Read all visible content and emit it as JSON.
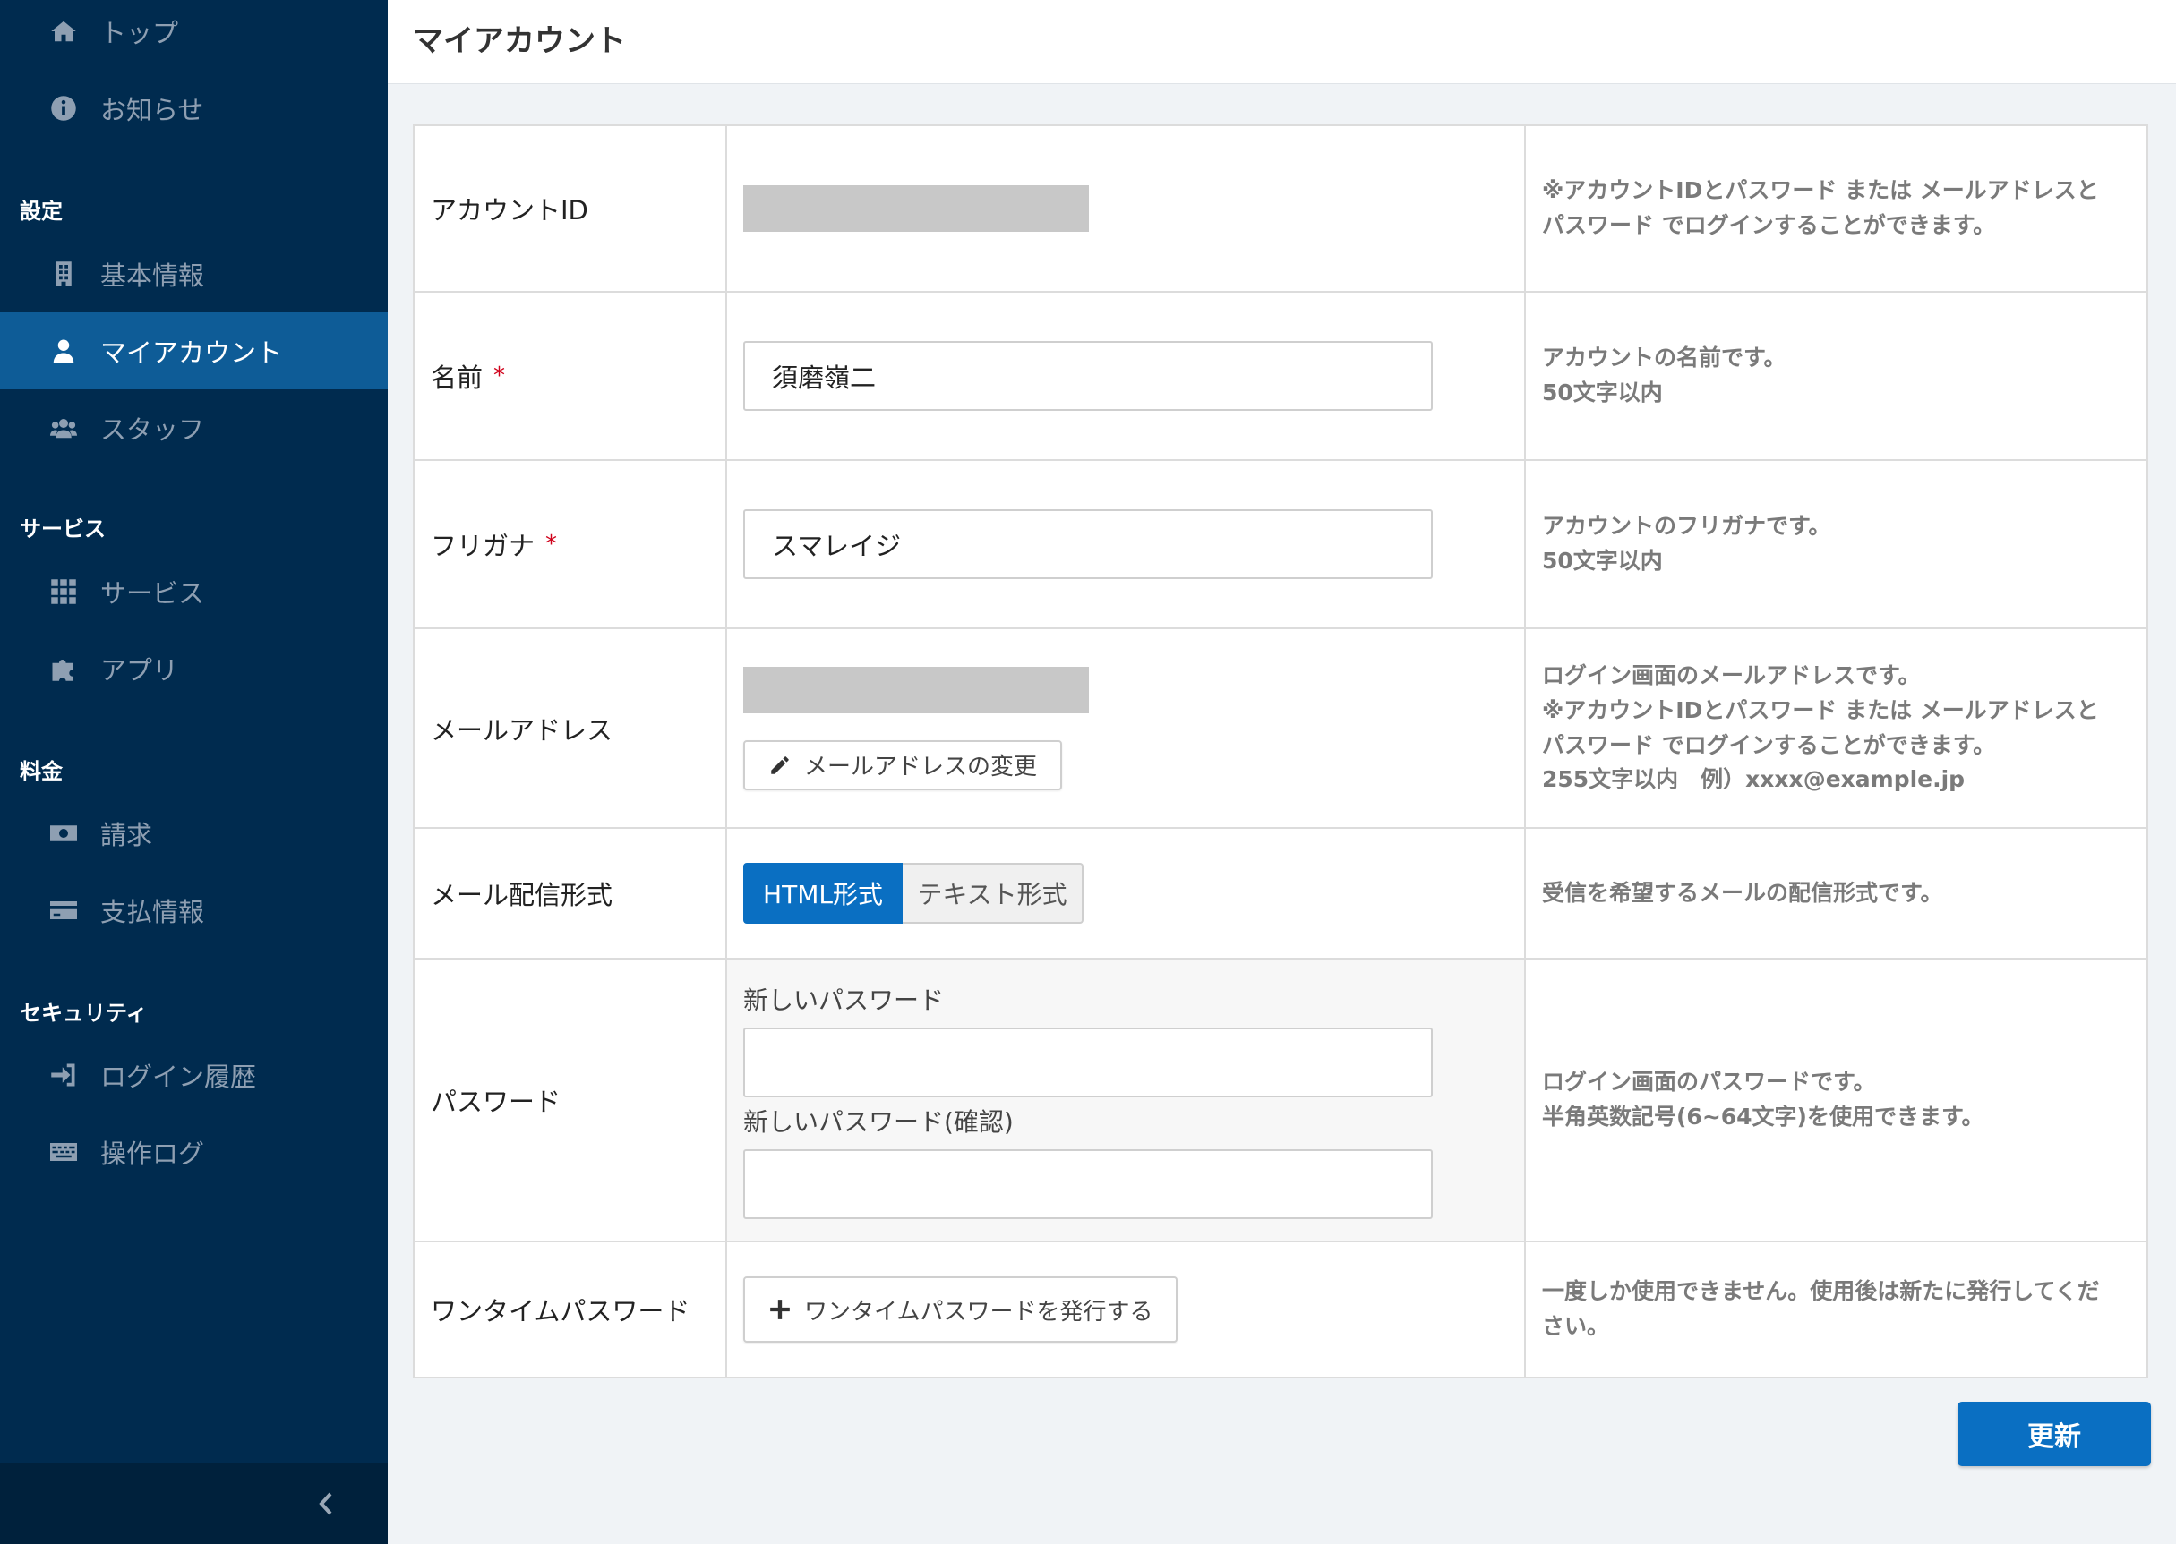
{
  "sidebar": {
    "items_top": [
      {
        "label": "トップ",
        "icon": "home-icon"
      },
      {
        "label": "お知らせ",
        "icon": "info-icon"
      }
    ],
    "sections": [
      {
        "title": "設定",
        "items": [
          {
            "label": "基本情報",
            "icon": "building-icon"
          },
          {
            "label": "マイアカウント",
            "icon": "user-icon",
            "active": true
          },
          {
            "label": "スタッフ",
            "icon": "users-icon"
          }
        ]
      },
      {
        "title": "サービス",
        "items": [
          {
            "label": "サービス",
            "icon": "grid-icon"
          },
          {
            "label": "アプリ",
            "icon": "puzzle-icon"
          }
        ]
      },
      {
        "title": "料金",
        "items": [
          {
            "label": "請求",
            "icon": "money-icon"
          },
          {
            "label": "支払情報",
            "icon": "credit-card-icon"
          }
        ]
      },
      {
        "title": "セキュリティ",
        "items": [
          {
            "label": "ログイン履歴",
            "icon": "sign-in-icon"
          },
          {
            "label": "操作ログ",
            "icon": "keyboard-icon"
          }
        ]
      }
    ]
  },
  "header": {
    "title": "マイアカウント"
  },
  "form": {
    "account_id": {
      "label": "アカウントID",
      "help": "※アカウントIDとパスワード または メールアドレスとパスワード でログインすることができます。"
    },
    "name": {
      "label": "名前",
      "required_mark": "*",
      "value": "須磨嶺二",
      "help_line1": "アカウントの名前です。",
      "help_line2": "50文字以内"
    },
    "furigana": {
      "label": "フリガナ",
      "required_mark": "*",
      "value": "スマレイジ",
      "help_line1": "アカウントのフリガナです。",
      "help_line2": "50文字以内"
    },
    "email": {
      "label": "メールアドレス",
      "change_button": "メールアドレスの変更",
      "help_line1": "ログイン画面のメールアドレスです。",
      "help_line2": "※アカウントIDとパスワード または メールアドレスとパスワード でログインすることができます。",
      "help_line3": "255文字以内　例）xxxx@example.jp"
    },
    "mail_format": {
      "label": "メール配信形式",
      "option_html": "HTML形式",
      "option_text": "テキスト形式",
      "selected": "HTML形式",
      "help": "受信を希望するメールの配信形式です。"
    },
    "password": {
      "label": "パスワード",
      "new_label": "新しいパスワード",
      "confirm_label": "新しいパスワード(確認)",
      "help_line1": "ログイン画面のパスワードです。",
      "help_line2": "半角英数記号(6~64文字)を使用できます。"
    },
    "otp": {
      "label": "ワンタイムパスワード",
      "button": "ワンタイムパスワードを発行する",
      "help": "一度しか使用できません。使用後は新たに発行してください。"
    }
  },
  "actions": {
    "update": "更新"
  },
  "colors": {
    "sidebar": "#002b4f",
    "active": "#0e5c97",
    "primary": "#0a6fc2",
    "required": "#d0021b"
  }
}
